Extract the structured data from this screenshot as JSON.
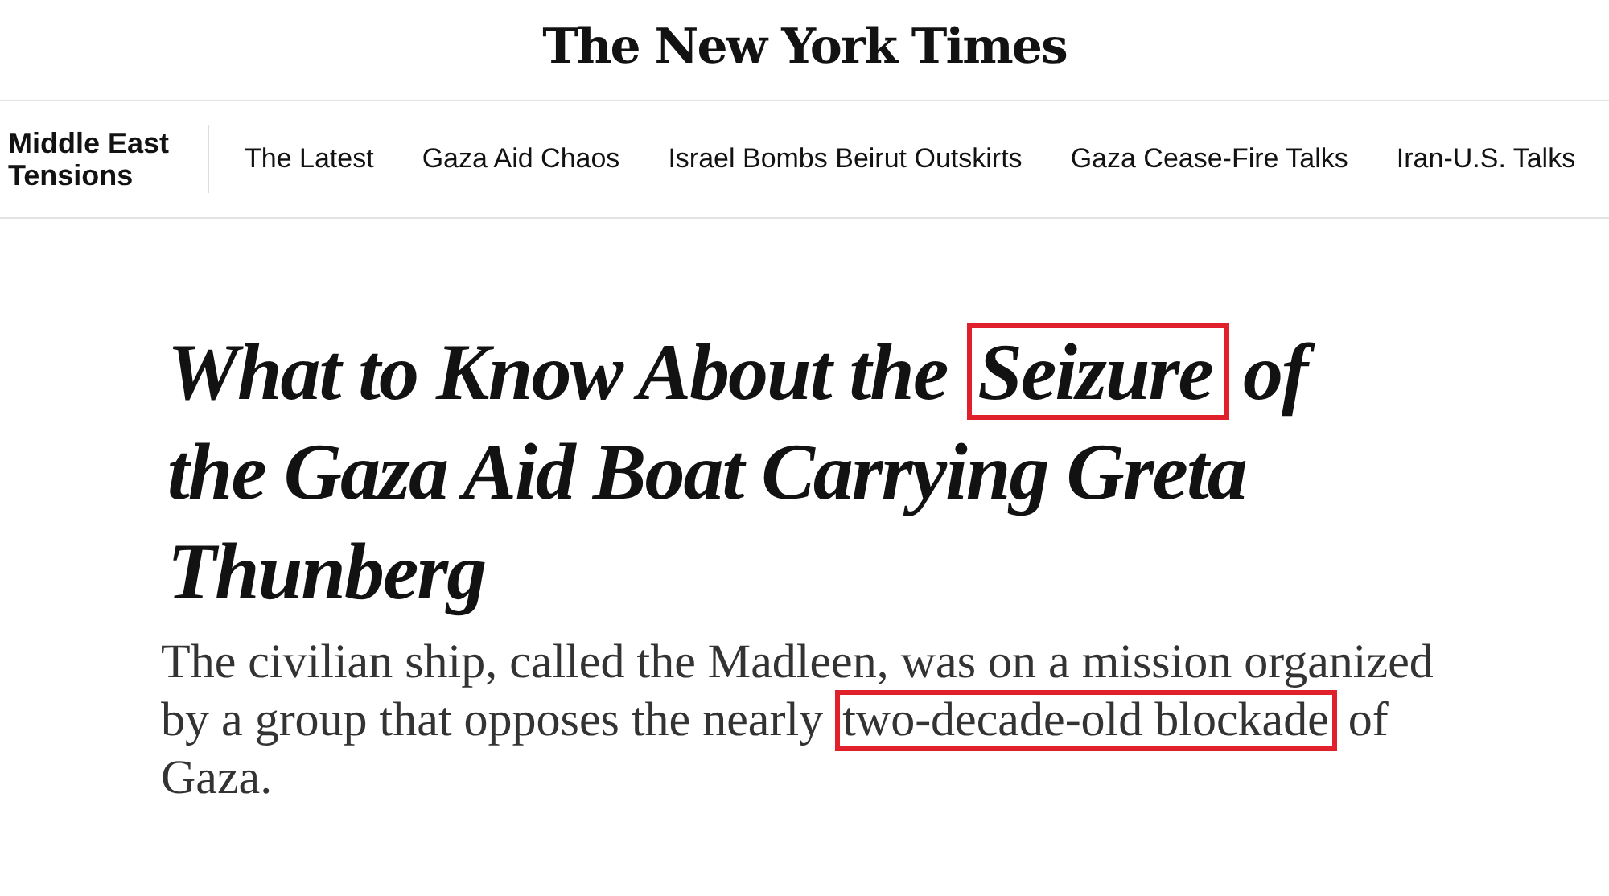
{
  "masthead": {
    "logo": "The New York Times"
  },
  "nav": {
    "section": "Middle East Tensions",
    "items": [
      {
        "label": "The Latest"
      },
      {
        "label": "Gaza Aid Chaos"
      },
      {
        "label": "Israel Bombs Beirut Outskirts"
      },
      {
        "label": "Gaza Cease-Fire Talks"
      },
      {
        "label": "Iran-U.S. Talks"
      }
    ]
  },
  "headline": [
    [
      {
        "text": "What to Know About the",
        "highlighted": false
      },
      {
        "text": "Seizure",
        "highlighted": true
      },
      {
        "text": "of",
        "highlighted": false
      }
    ],
    [
      {
        "text": "the Gaza Aid Boat Carrying Greta",
        "highlighted": false
      }
    ],
    [
      {
        "text": "Thunberg",
        "highlighted": false
      }
    ]
  ],
  "summary": [
    [
      {
        "text": "The civilian ship, called the Madleen, was on a mission organized",
        "highlighted": false
      }
    ],
    [
      {
        "text": "by a group that opposes the nearly",
        "highlighted": false
      },
      {
        "text": "two-decade-old blockade",
        "highlighted": true
      },
      {
        "text": "of",
        "highlighted": false
      }
    ],
    [
      {
        "text": "Gaza.",
        "highlighted": false
      }
    ]
  ]
}
